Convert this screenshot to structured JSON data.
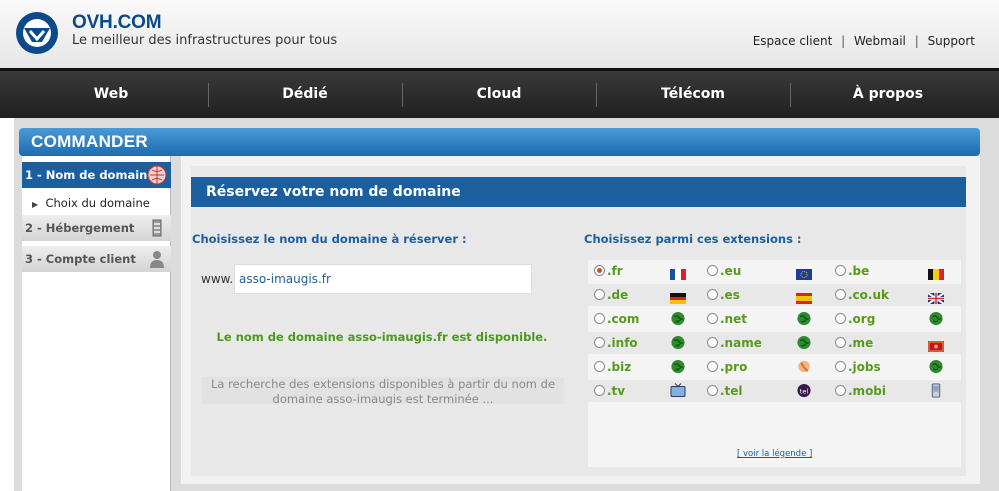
{
  "header": {
    "brand": "OVH.COM",
    "tagline": "Le meilleur des infrastructures pour tous",
    "links": [
      "Espace client",
      "Webmail",
      "Support"
    ]
  },
  "nav": [
    "Web",
    "Dédié",
    "Cloud",
    "Télécom",
    "À propos"
  ],
  "commander": "COMMANDER",
  "sidebar": {
    "steps": [
      {
        "label": "1 - Nom de domaine",
        "icon": "globe-icon"
      },
      {
        "label": "2 - Hébergement",
        "icon": "server-icon"
      },
      {
        "label": "3 - Compte client",
        "icon": "user-lock-icon"
      }
    ],
    "substep": "Choix du domaine"
  },
  "main": {
    "title": "Réservez votre nom de domaine",
    "choose_label": "Choisissez le nom du domaine à réserver :",
    "ext_label": "Choisissez parmi ces extensions :",
    "www": "www.",
    "domain_value": "asso-imaugis.fr",
    "available": "Le nom de domaine asso-imaugis.fr est disponible.",
    "search_done_1": "La recherche des extensions disponibles à partir du nom de",
    "search_done_2": "domaine asso-imaugis est terminée ...",
    "legend_link": "[ voir la légende ]"
  },
  "extensions": [
    [
      {
        "ext": ".fr",
        "icon": "flag-fr-icon",
        "checked": true
      },
      {
        "ext": ".eu",
        "icon": "flag-eu-icon"
      },
      {
        "ext": ".be",
        "icon": "flag-be-icon"
      }
    ],
    [
      {
        "ext": ".de",
        "icon": "flag-de-icon"
      },
      {
        "ext": ".es",
        "icon": "flag-es-icon"
      },
      {
        "ext": ".co.uk",
        "icon": "flag-uk-icon"
      }
    ],
    [
      {
        "ext": ".com",
        "icon": "globe-icon"
      },
      {
        "ext": ".net",
        "icon": "globe-icon"
      },
      {
        "ext": ".org",
        "icon": "globe-icon"
      }
    ],
    [
      {
        "ext": ".info",
        "icon": "globe-icon"
      },
      {
        "ext": ".name",
        "icon": "globe-icon"
      },
      {
        "ext": ".me",
        "icon": "flag-me-icon"
      }
    ],
    [
      {
        "ext": ".biz",
        "icon": "globe-icon"
      },
      {
        "ext": ".pro",
        "icon": "badge-icon"
      },
      {
        "ext": ".jobs",
        "icon": "globe-icon"
      }
    ],
    [
      {
        "ext": ".tv",
        "icon": "tv-icon"
      },
      {
        "ext": ".tel",
        "icon": "tel-icon"
      },
      {
        "ext": ".mobi",
        "icon": "mobile-icon"
      }
    ]
  ]
}
